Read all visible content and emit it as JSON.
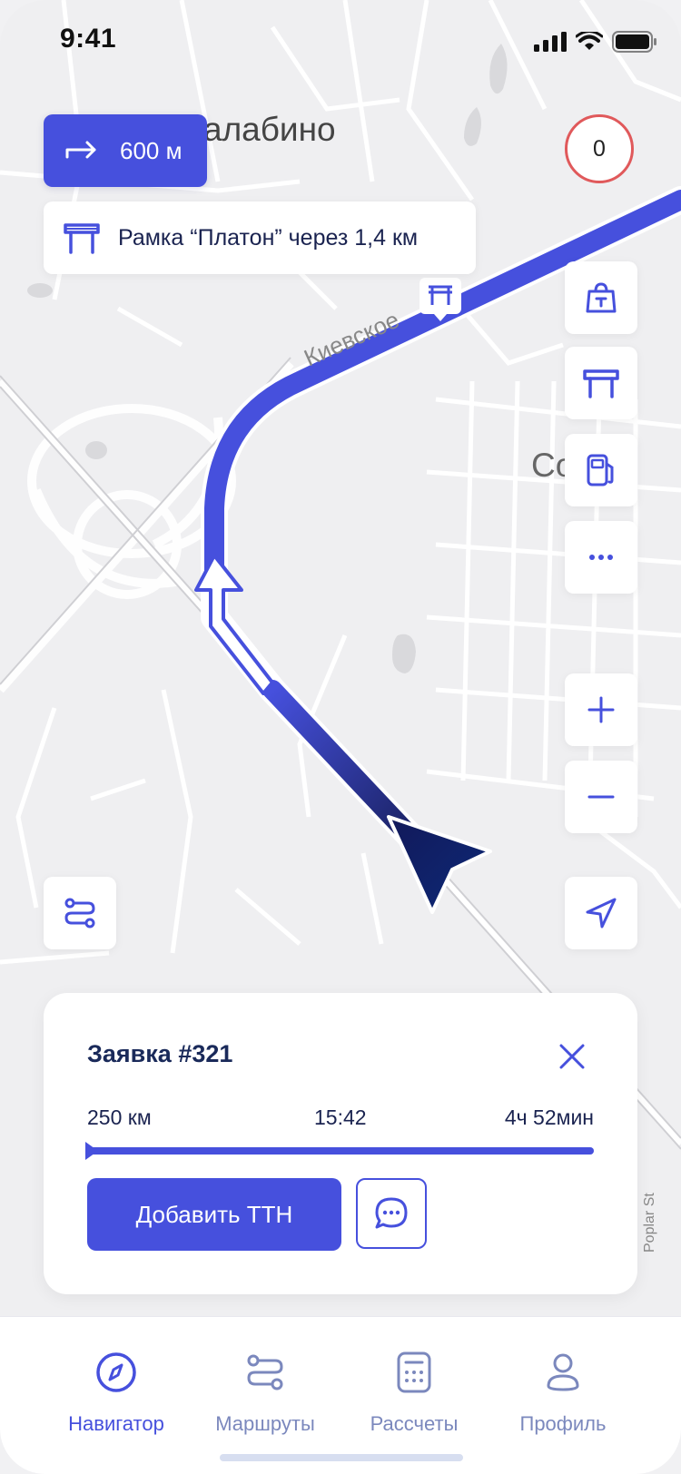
{
  "status": {
    "time": "9:41"
  },
  "map": {
    "place_top": "алабино",
    "place_right": "Со        но"
  },
  "turn": {
    "distance": "600 м",
    "icon": "turn-right-arrow-icon"
  },
  "toll_notice": {
    "text": "Рамка “Платон” через 1,4 км",
    "icon": "toll-gate-icon"
  },
  "counter": {
    "value": "0"
  },
  "side_buttons": [
    "bag-icon",
    "toll-gate-icon",
    "fuel-station-icon",
    "more-icon",
    "zoom-in-icon",
    "zoom-out-icon",
    "locate-icon"
  ],
  "route_button_icon": "route-icon",
  "order": {
    "title": "Заявка #321",
    "distance": "250 км",
    "arrival_time": "15:42",
    "duration": "4ч 52мин",
    "progress": 1.0,
    "add_button": "Добавить ТТН",
    "chat_icon": "chat-icon",
    "close_icon": "close-icon"
  },
  "tabs": [
    {
      "label": "Навигатор",
      "icon": "compass-icon",
      "active": true
    },
    {
      "label": "Маршруты",
      "icon": "route-icon",
      "active": false
    },
    {
      "label": "Рассчеты",
      "icon": "calculator-icon",
      "active": false
    },
    {
      "label": "Профиль",
      "icon": "profile-icon",
      "active": false
    }
  ],
  "colors": {
    "accent": "#4650dd",
    "route_dark": "#1e2670",
    "danger_ring": "#e0595b",
    "text_dark": "#1a2a5a"
  }
}
